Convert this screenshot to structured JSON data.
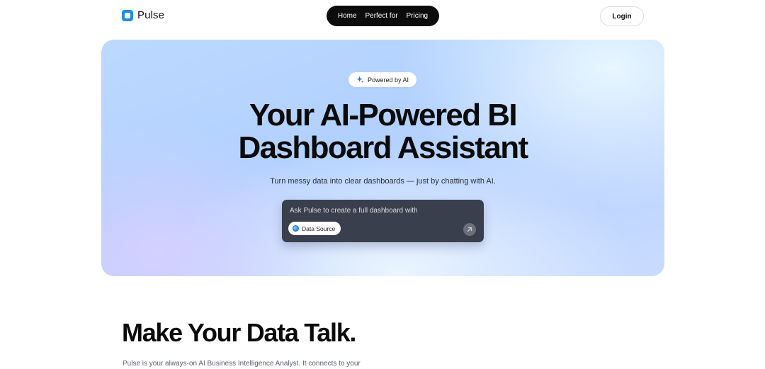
{
  "header": {
    "logo_text": "Pulse",
    "nav": [
      {
        "label": "Home"
      },
      {
        "label": "Perfect for"
      },
      {
        "label": "Pricing"
      }
    ],
    "login_label": "Login"
  },
  "hero": {
    "badge": "Powered by AI",
    "title_line1": "Your AI-Powered BI",
    "title_line2": "Dashboard Assistant",
    "subtitle": "Turn messy data into clear dashboards — just by chatting with AI.",
    "prompt": {
      "placeholder": "Ask Pulse to create a full dashboard with",
      "chip_label": "Data Source"
    }
  },
  "section": {
    "title": "Make Your Data Talk.",
    "body": "Pulse is your always-on AI Business Intelligence Analyst. It connects to your"
  },
  "icons": {
    "logo": "pulse-logo-icon",
    "badge": "sparkle-icon",
    "chip": "database-icon",
    "send": "arrow-up-right-icon"
  },
  "colors": {
    "brand": "#1d8cf0",
    "nav_bg": "#0c0c0c",
    "prompt_bg": "#3a3f4d"
  }
}
